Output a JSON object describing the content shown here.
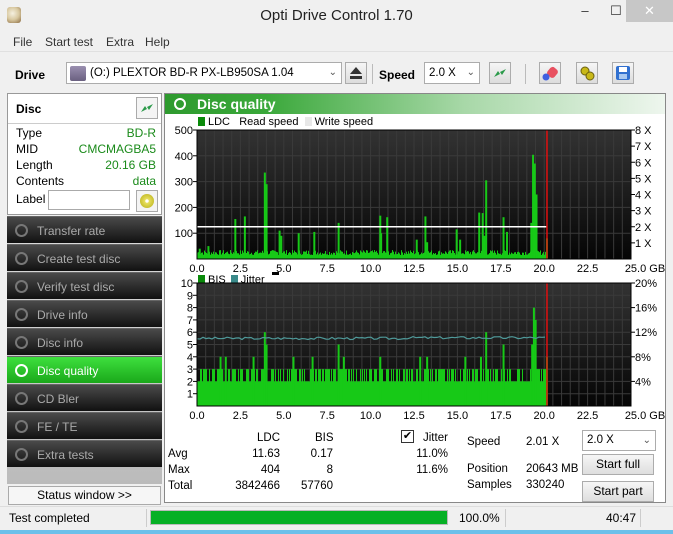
{
  "window": {
    "title": "Opti Drive Control 1.70",
    "minimize": "‒",
    "maximize": "☐",
    "close": "✕"
  },
  "menu": [
    "File",
    "Start test",
    "Extra",
    "Help"
  ],
  "toolbar": {
    "drive_label": "Drive",
    "drive_value": "(O:)  PLEXTOR BD-R  PX-LB950SA 1.04",
    "speed_label": "Speed",
    "speed_value": "2.0 X",
    "icons": [
      "eject-icon",
      "refresh-icon",
      "erase-icon",
      "settings-icon",
      "save-icon"
    ]
  },
  "disc": {
    "header": "Disc",
    "rows": [
      {
        "key": "Type",
        "value": "BD-R"
      },
      {
        "key": "MID",
        "value": "CMCMAGBA5"
      },
      {
        "key": "Length",
        "value": "20.16 GB"
      },
      {
        "key": "Contents",
        "value": "data"
      }
    ],
    "label_key": "Label",
    "label_value": ""
  },
  "nav": [
    {
      "label": "Transfer rate",
      "active": false
    },
    {
      "label": "Create test disc",
      "active": false
    },
    {
      "label": "Verify test disc",
      "active": false
    },
    {
      "label": "Drive info",
      "active": false
    },
    {
      "label": "Disc info",
      "active": false
    },
    {
      "label": "Disc quality",
      "active": true
    },
    {
      "label": "CD Bler",
      "active": false
    },
    {
      "label": "FE / TE",
      "active": false
    },
    {
      "label": "Extra tests",
      "active": false
    }
  ],
  "status_window_button": "Status window >>",
  "panel": {
    "title": "Disc quality"
  },
  "colors": {
    "ldc": "#17c917",
    "bis": "#17c917",
    "jitter": "#4f9a9a",
    "read_speed": "#ffffff",
    "end_marker": "#e01010",
    "plot_bg_top": "#333333",
    "plot_bg_bottom": "#050505",
    "legend_ldc": "#0a8a0a",
    "legend_jitter": "#3a8a8a"
  },
  "chart_data": [
    {
      "type": "bar",
      "title": "LDC",
      "legend": [
        "LDC",
        "Read speed",
        "Write speed"
      ],
      "xlabel": "GB",
      "xlim": [
        0,
        25
      ],
      "xticks": [
        "0.0",
        "2.5",
        "5.0",
        "7.5",
        "10.0",
        "12.5",
        "15.0",
        "17.5",
        "20.0",
        "22.5",
        "25.0 GB"
      ],
      "ylim": [
        0,
        500
      ],
      "yticks": [
        "100",
        "200",
        "300",
        "400",
        "500"
      ],
      "y2lim": [
        0,
        8
      ],
      "y2ticks": [
        "1 X",
        "2 X",
        "3 X",
        "4 X",
        "5 X",
        "6 X",
        "7 X",
        "8 X"
      ],
      "baseline": 28,
      "spikes": [
        {
          "x": 0.1,
          "y": 40
        },
        {
          "x": 0.6,
          "y": 50
        },
        {
          "x": 2.15,
          "y": 155
        },
        {
          "x": 2.7,
          "y": 165
        },
        {
          "x": 3.85,
          "y": 335
        },
        {
          "x": 3.95,
          "y": 290
        },
        {
          "x": 4.7,
          "y": 110
        },
        {
          "x": 4.8,
          "y": 90
        },
        {
          "x": 5.8,
          "y": 100
        },
        {
          "x": 6.7,
          "y": 105
        },
        {
          "x": 8.1,
          "y": 140
        },
        {
          "x": 10.5,
          "y": 168
        },
        {
          "x": 10.55,
          "y": 100
        },
        {
          "x": 10.9,
          "y": 162
        },
        {
          "x": 12.6,
          "y": 75
        },
        {
          "x": 13.1,
          "y": 165
        },
        {
          "x": 13.2,
          "y": 65
        },
        {
          "x": 14.9,
          "y": 115
        },
        {
          "x": 15.1,
          "y": 75
        },
        {
          "x": 16.2,
          "y": 180
        },
        {
          "x": 16.4,
          "y": 178
        },
        {
          "x": 16.6,
          "y": 305
        },
        {
          "x": 16.5,
          "y": 90
        },
        {
          "x": 17.6,
          "y": 162
        },
        {
          "x": 17.8,
          "y": 105
        },
        {
          "x": 19.3,
          "y": 404
        },
        {
          "x": 19.4,
          "y": 370
        },
        {
          "x": 19.5,
          "y": 250
        },
        {
          "x": 19.2,
          "y": 140
        },
        {
          "x": 20.1,
          "y": 80
        }
      ],
      "read_speed_x": 2.0,
      "end_x": 20.16
    },
    {
      "type": "bar",
      "title": "BIS / Jitter",
      "legend": [
        "BIS",
        "Jitter"
      ],
      "xlabel": "GB",
      "xlim": [
        0,
        25
      ],
      "xticks": [
        "0.0",
        "2.5",
        "5.0",
        "7.5",
        "10.0",
        "12.5",
        "15.0",
        "17.5",
        "20.0",
        "22.5",
        "25.0 GB"
      ],
      "ylim": [
        0,
        10
      ],
      "yticks": [
        "1",
        "2",
        "3",
        "4",
        "5",
        "6",
        "7",
        "8",
        "9",
        "10"
      ],
      "y2lim": [
        0,
        20
      ],
      "y2ticks": [
        "4%",
        "8%",
        "12%",
        "16%",
        "20%"
      ],
      "bis_baseline": 2,
      "bis_spikes": [
        {
          "x": 1.3,
          "y": 4
        },
        {
          "x": 1.6,
          "y": 4
        },
        {
          "x": 3.2,
          "y": 4
        },
        {
          "x": 3.85,
          "y": 6
        },
        {
          "x": 3.95,
          "y": 5
        },
        {
          "x": 5.5,
          "y": 4
        },
        {
          "x": 6.6,
          "y": 4
        },
        {
          "x": 8.1,
          "y": 5
        },
        {
          "x": 8.4,
          "y": 4
        },
        {
          "x": 10.5,
          "y": 4
        },
        {
          "x": 12.8,
          "y": 4
        },
        {
          "x": 13.2,
          "y": 4
        },
        {
          "x": 15.4,
          "y": 4
        },
        {
          "x": 16.6,
          "y": 6
        },
        {
          "x": 16.3,
          "y": 4
        },
        {
          "x": 17.6,
          "y": 5
        },
        {
          "x": 19.25,
          "y": 5
        },
        {
          "x": 19.35,
          "y": 8
        },
        {
          "x": 19.45,
          "y": 7
        },
        {
          "x": 20.1,
          "y": 4
        }
      ],
      "jitter_avg": 11.0,
      "jitter_max": 11.6,
      "end_x": 20.16
    }
  ],
  "stats": {
    "col_ldc": "LDC",
    "col_bis": "BIS",
    "jitter_label": "Jitter",
    "jitter_checked": true,
    "rows": [
      {
        "label": "Avg",
        "ldc": "11.63",
        "bis": "0.17",
        "jitter": "11.0%"
      },
      {
        "label": "Max",
        "ldc": "404",
        "bis": "8",
        "jitter": "11.6%"
      },
      {
        "label": "Total",
        "ldc": "3842466",
        "bis": "57760",
        "jitter": ""
      }
    ],
    "speed_label": "Speed",
    "speed_value": "2.01 X",
    "position_label": "Position",
    "position_value": "20643 MB",
    "samples_label": "Samples",
    "samples_value": "330240",
    "speed_select": "2.0 X",
    "start_full": "Start full",
    "start_part": "Start part"
  },
  "statusbar": {
    "text": "Test completed",
    "progress": 100.0,
    "progress_text": "100.0%",
    "time": "40:47"
  }
}
